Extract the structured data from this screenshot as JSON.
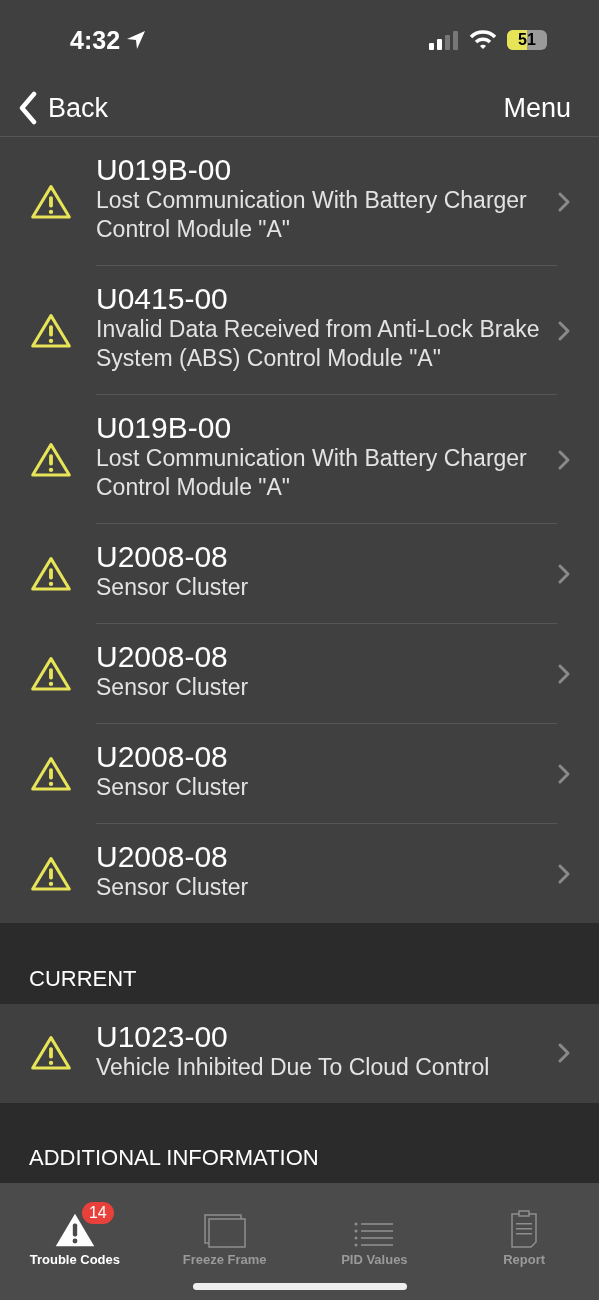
{
  "status_bar": {
    "time": "4:32",
    "battery": "51"
  },
  "nav": {
    "back": "Back",
    "menu": "Menu"
  },
  "sections": [
    {
      "codes": [
        {
          "code": "U019B-00",
          "description": "Lost Communication With Battery Charger Control Module \"A\""
        },
        {
          "code": "U0415-00",
          "description": "Invalid Data Received from Anti-Lock Brake System (ABS) Control Module \"A\""
        },
        {
          "code": "U019B-00",
          "description": "Lost Communication With Battery Charger Control Module \"A\""
        },
        {
          "code": "U2008-08",
          "description": "Sensor Cluster"
        },
        {
          "code": "U2008-08",
          "description": "Sensor Cluster"
        },
        {
          "code": "U2008-08",
          "description": "Sensor Cluster"
        },
        {
          "code": "U2008-08",
          "description": "Sensor Cluster"
        }
      ]
    },
    {
      "header": "CURRENT",
      "codes": [
        {
          "code": "U1023-00",
          "description": "Vehicle Inhibited Due To Cloud Control"
        }
      ]
    },
    {
      "header": "ADDITIONAL INFORMATION"
    }
  ],
  "tabs": [
    {
      "label": "Trouble Codes",
      "selected": true,
      "badge": "14"
    },
    {
      "label": "Freeze Frame",
      "selected": false
    },
    {
      "label": "PID Values",
      "selected": false
    },
    {
      "label": "Report",
      "selected": false
    }
  ]
}
